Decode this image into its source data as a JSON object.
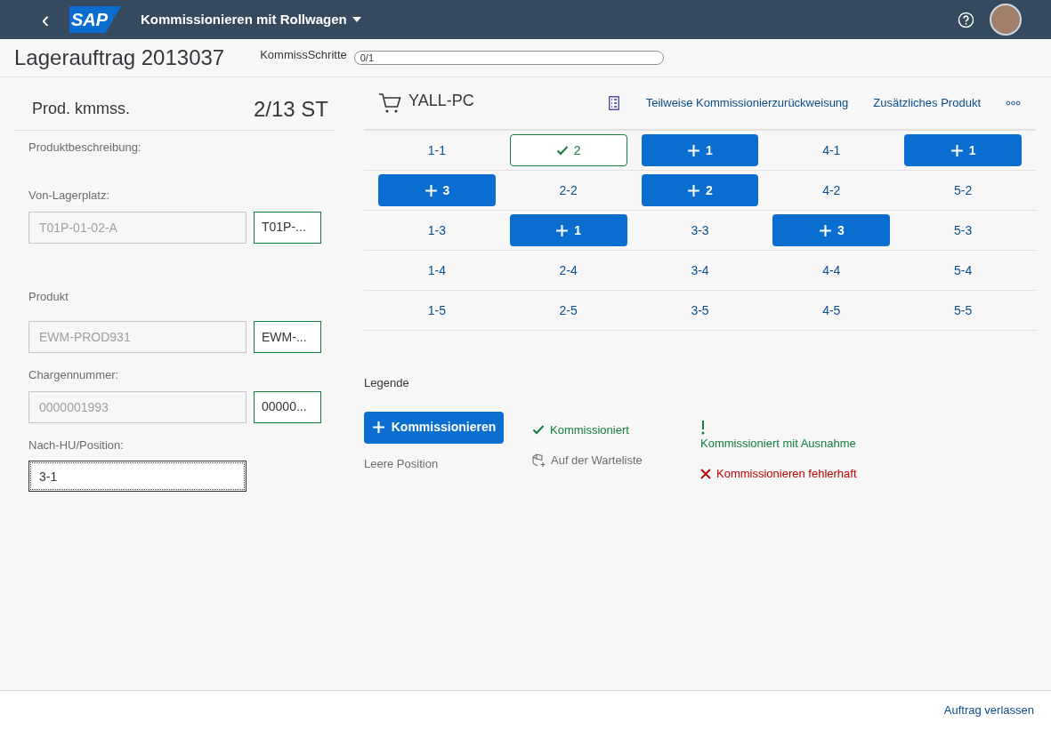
{
  "shell": {
    "back": "‹",
    "logo": "SAP",
    "title": "Kommissionieren mit Rollwagen"
  },
  "header": {
    "title": "Lagerauftrag 2013037",
    "progress_label": "KommissSchritte",
    "progress": {
      "text": "0/1",
      "level": 0
    }
  },
  "left": {
    "title": "Prod. kmmss.",
    "quantity": "2/13 ST",
    "fields": [
      {
        "kind": "label",
        "label": "Produktbeschreibung:"
      },
      {
        "kind": "pair",
        "label": "Von-Lagerplatz:",
        "placeholder": "T01P-01-02-A",
        "button": "T01P-..."
      },
      {
        "kind": "pair",
        "label": "Produkt",
        "placeholder": "EWM-PROD931",
        "button": "EWM-..."
      },
      {
        "kind": "pair",
        "label": "Chargennummer:",
        "placeholder": "0000001993",
        "button": "00000..."
      },
      {
        "kind": "input",
        "label": "Nach-HU/Position:",
        "value": "3-1"
      }
    ]
  },
  "cart": {
    "name": "YALL-PC",
    "actions": [
      "Teilweise Kommissionierzurückweisung",
      "Zusätzliches Produkt"
    ],
    "rows": [
      [
        {
          "kind": "empty",
          "text": "1-1"
        },
        {
          "kind": "picked",
          "text": "2"
        },
        {
          "kind": "pick",
          "text": "1"
        },
        {
          "kind": "empty",
          "text": "4-1"
        },
        {
          "kind": "pick",
          "text": "1"
        }
      ],
      [
        {
          "kind": "pick",
          "text": "3"
        },
        {
          "kind": "empty",
          "text": "2-2"
        },
        {
          "kind": "pick",
          "text": "2"
        },
        {
          "kind": "empty",
          "text": "4-2"
        },
        {
          "kind": "empty",
          "text": "5-2"
        }
      ],
      [
        {
          "kind": "empty",
          "text": "1-3"
        },
        {
          "kind": "pick",
          "text": "1"
        },
        {
          "kind": "empty",
          "text": "3-3"
        },
        {
          "kind": "pick",
          "text": "3"
        },
        {
          "kind": "empty",
          "text": "5-3"
        }
      ],
      [
        {
          "kind": "empty",
          "text": "1-4"
        },
        {
          "kind": "empty",
          "text": "2-4"
        },
        {
          "kind": "empty",
          "text": "3-4"
        },
        {
          "kind": "empty",
          "text": "4-4"
        },
        {
          "kind": "empty",
          "text": "5-4"
        }
      ],
      [
        {
          "kind": "empty",
          "text": "1-5"
        },
        {
          "kind": "empty",
          "text": "2-5"
        },
        {
          "kind": "empty",
          "text": "3-5"
        },
        {
          "kind": "empty",
          "text": "4-5"
        },
        {
          "kind": "empty",
          "text": "5-5"
        }
      ]
    ]
  },
  "legend": {
    "title": "Legende",
    "pick_button": "Kommissionieren",
    "empty": "Leere Position",
    "picked": "Kommissioniert",
    "waiting": "Auf der Warteliste",
    "exception": "Kommissioniert mit Ausnahme",
    "error": "Kommissionieren fehlerhaft"
  },
  "footer": {
    "button": "Auftrag verlassen"
  }
}
